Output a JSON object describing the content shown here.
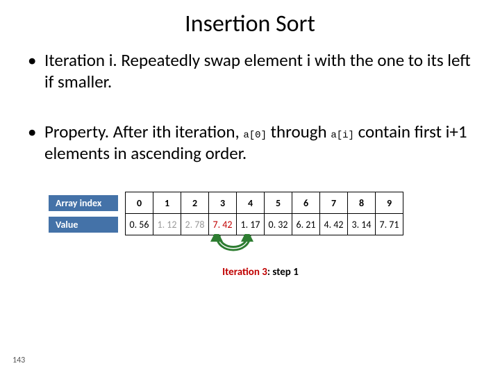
{
  "title": "Insertion Sort",
  "bullets": {
    "b1_pre": "Iteration i.  Repeatedly swap element i with the one to its left if smaller.",
    "b2_pre": "Property.  After ith iteration, ",
    "b2_code1": "a[0]",
    "b2_mid": " through ",
    "b2_code2": "a[i]",
    "b2_post": " contain first i+1 elements in ascending order."
  },
  "table": {
    "row1_label": "Array index",
    "row2_label": "Value",
    "indices": [
      "0",
      "1",
      "2",
      "3",
      "4",
      "5",
      "6",
      "7",
      "8",
      "9"
    ],
    "values": [
      {
        "text": "0. 56",
        "cls": "v-black"
      },
      {
        "text": "1. 12",
        "cls": "v-gray"
      },
      {
        "text": "2. 78",
        "cls": "v-gray"
      },
      {
        "text": "7. 42",
        "cls": "v-red"
      },
      {
        "text": "1. 17",
        "cls": "v-black"
      },
      {
        "text": "0. 32",
        "cls": "v-black"
      },
      {
        "text": "6. 21",
        "cls": "v-black"
      },
      {
        "text": "4. 42",
        "cls": "v-black"
      },
      {
        "text": "3. 14",
        "cls": "v-black"
      },
      {
        "text": "7. 71",
        "cls": "v-black"
      }
    ]
  },
  "caption": {
    "iter_label": "Iteration ",
    "iter_num": "3",
    "sep": ":  ",
    "step_label": "step ",
    "step_num": "1"
  },
  "page_number": "143",
  "chart_data": {
    "type": "table",
    "title": "Insertion Sort — iteration 3, step 1",
    "columns": [
      "Array index",
      "Value"
    ],
    "indices": [
      0,
      1,
      2,
      3,
      4,
      5,
      6,
      7,
      8,
      9
    ],
    "values": [
      0.56,
      1.12,
      2.78,
      7.42,
      1.17,
      0.32,
      6.21,
      4.42,
      3.14,
      7.71
    ],
    "highlight": {
      "swap_indices": [
        2,
        3
      ],
      "sorted_prefix_through": 2,
      "active_element_index": 3
    }
  }
}
